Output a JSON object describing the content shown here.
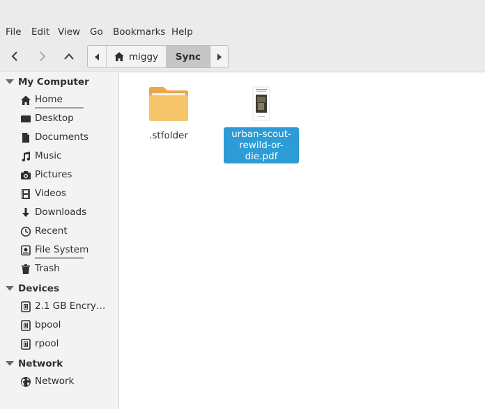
{
  "menubar": {
    "items": [
      {
        "label": "File"
      },
      {
        "label": "Edit"
      },
      {
        "label": "View"
      },
      {
        "label": "Go"
      },
      {
        "label": "Bookmarks"
      },
      {
        "label": "Help"
      }
    ]
  },
  "toolbar": {
    "back_icon": "chevron-left-icon",
    "forward_icon": "chevron-right-icon",
    "up_icon": "chevron-up-icon",
    "pathbar": {
      "home_label": "miggy",
      "current_label": "Sync"
    }
  },
  "sidebar": {
    "sections": [
      {
        "title": "My Computer",
        "items": [
          {
            "label": "Home",
            "icon": "home-icon"
          },
          {
            "label": "Desktop",
            "icon": "desktop-icon"
          },
          {
            "label": "Documents",
            "icon": "document-icon"
          },
          {
            "label": "Music",
            "icon": "music-icon"
          },
          {
            "label": "Pictures",
            "icon": "camera-icon"
          },
          {
            "label": "Videos",
            "icon": "film-icon"
          },
          {
            "label": "Downloads",
            "icon": "download-icon"
          },
          {
            "label": "Recent",
            "icon": "clock-icon"
          },
          {
            "label": "File System",
            "icon": "drive-icon"
          },
          {
            "label": "Trash",
            "icon": "trash-icon"
          }
        ]
      },
      {
        "title": "Devices",
        "items": [
          {
            "label": "2.1 GB Encry…",
            "icon": "chip-icon"
          },
          {
            "label": "bpool",
            "icon": "chip-icon"
          },
          {
            "label": "rpool",
            "icon": "chip-icon"
          }
        ]
      },
      {
        "title": "Network",
        "items": [
          {
            "label": "Network",
            "icon": "globe-icon"
          }
        ]
      }
    ]
  },
  "content": {
    "files": [
      {
        "name": ".stfolder",
        "type": "folder",
        "selected": false
      },
      {
        "name_line1": "urban-scout-",
        "name_line2": "rewild-or-die.pdf",
        "type": "pdf",
        "selected": true
      }
    ]
  },
  "colors": {
    "selection": "#2c9bd6",
    "folder": "#f6c66d",
    "sidebar_bg": "#f3f3f3",
    "toolbar_bg": "#ebebeb"
  }
}
